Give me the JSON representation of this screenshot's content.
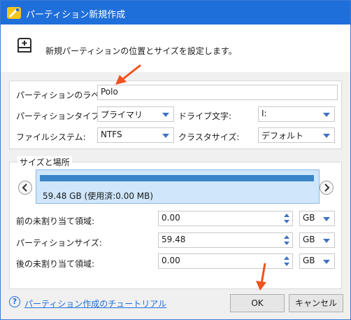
{
  "window": {
    "title": "パーティション新規作成",
    "header_text": "新規パーティションの位置とサイズを設定します。"
  },
  "partition_settings": {
    "label_label": "パーティションのラベル:",
    "label_value": "Polo",
    "type_label": "パーティションタイプ:",
    "type_value": "プライマリ",
    "drive_letter_label": "ドライブ文字:",
    "drive_letter_value": "I:",
    "filesystem_label": "ファイルシステム:",
    "filesystem_value": "NTFS",
    "cluster_size_label": "クラスタサイズ:",
    "cluster_size_value": "デフォルト"
  },
  "size_location": {
    "section_title": "サイズと場所",
    "bar_text": "59.48 GB (使用済:0.00 MB)",
    "before_label": "前の未割り当て領域:",
    "before_value": "0.00",
    "before_unit": "GB",
    "size_label": "パーティションサイズ:",
    "size_value": "59.48",
    "size_unit": "GB",
    "after_label": "後の未割り当て領域:",
    "after_value": "0.00",
    "after_unit": "GB"
  },
  "footer": {
    "help_link": "パーティション作成のチュートリアル",
    "ok_label": "OK",
    "cancel_label": "キャンセル"
  },
  "colors": {
    "titlebar": "#1f6fdb",
    "annotation_arrow": "#f0521e",
    "bar_fill": "#3a85c9"
  }
}
